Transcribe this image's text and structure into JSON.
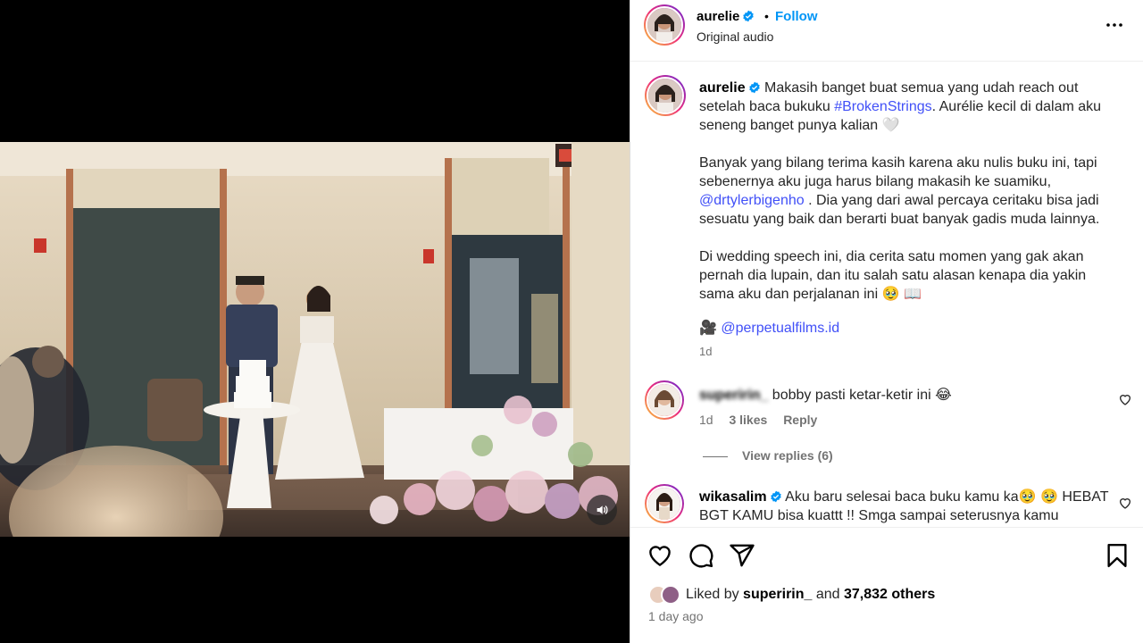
{
  "post": {
    "username": "aurelie",
    "follow_label": "Follow",
    "separator": "•",
    "audio_label": "Original audio"
  },
  "caption": {
    "username": "aurelie",
    "p1_a": "Makasih banget buat semua yang udah reach out setelah baca bukuku ",
    "p1_hashtag": "#BrokenStrings",
    "p1_b": ". Aurélie kecil di dalam aku seneng banget punya kalian 🤍",
    "p2_a": "Banyak yang bilang terima kasih karena aku nulis buku ini, tapi sebenernya aku juga harus bilang makasih ke suamiku, ",
    "p2_mention": "@drtylerbigenho",
    "p2_b": " . Dia yang dari awal percaya ceritaku bisa jadi sesuatu yang baik dan berarti buat banyak gadis muda lainnya.",
    "p3": "Di wedding speech ini, dia cerita satu momen yang gak akan pernah dia lupain, dan itu salah satu alasan kenapa dia yakin sama aku dan perjalanan ini 🥹 📖",
    "credit_icon": "🎥",
    "credit": "@perpetualfilms.id",
    "time": "1d"
  },
  "comments": [
    {
      "username": "superirin_",
      "text": " bobby pasti ketar-ketir ini 😂",
      "time": "1d",
      "likes": "3 likes",
      "reply": "Reply"
    },
    {
      "username": "wikasalim",
      "text": " Aku baru selesai baca buku kamu ka🥹 🥹 HEBAT BGT KAMU bisa kuattt !! Smga sampai seterusnya kamu"
    }
  ],
  "view_replies": "View replies (6)",
  "likes": {
    "prefix": "Liked by ",
    "user": "superirin_",
    "mid": " and ",
    "count": "37,832 others"
  },
  "posted_ago": "1 day ago",
  "icons": {
    "verified": "verified-badge-icon",
    "more": "more-options-icon",
    "like": "heart-icon",
    "comment": "comment-icon",
    "share": "share-icon",
    "save": "bookmark-icon",
    "mute": "speaker-icon"
  },
  "colors": {
    "link": "#4150f7",
    "follow": "#0095f6",
    "verified": "#0095f6",
    "muted": "#737373"
  }
}
